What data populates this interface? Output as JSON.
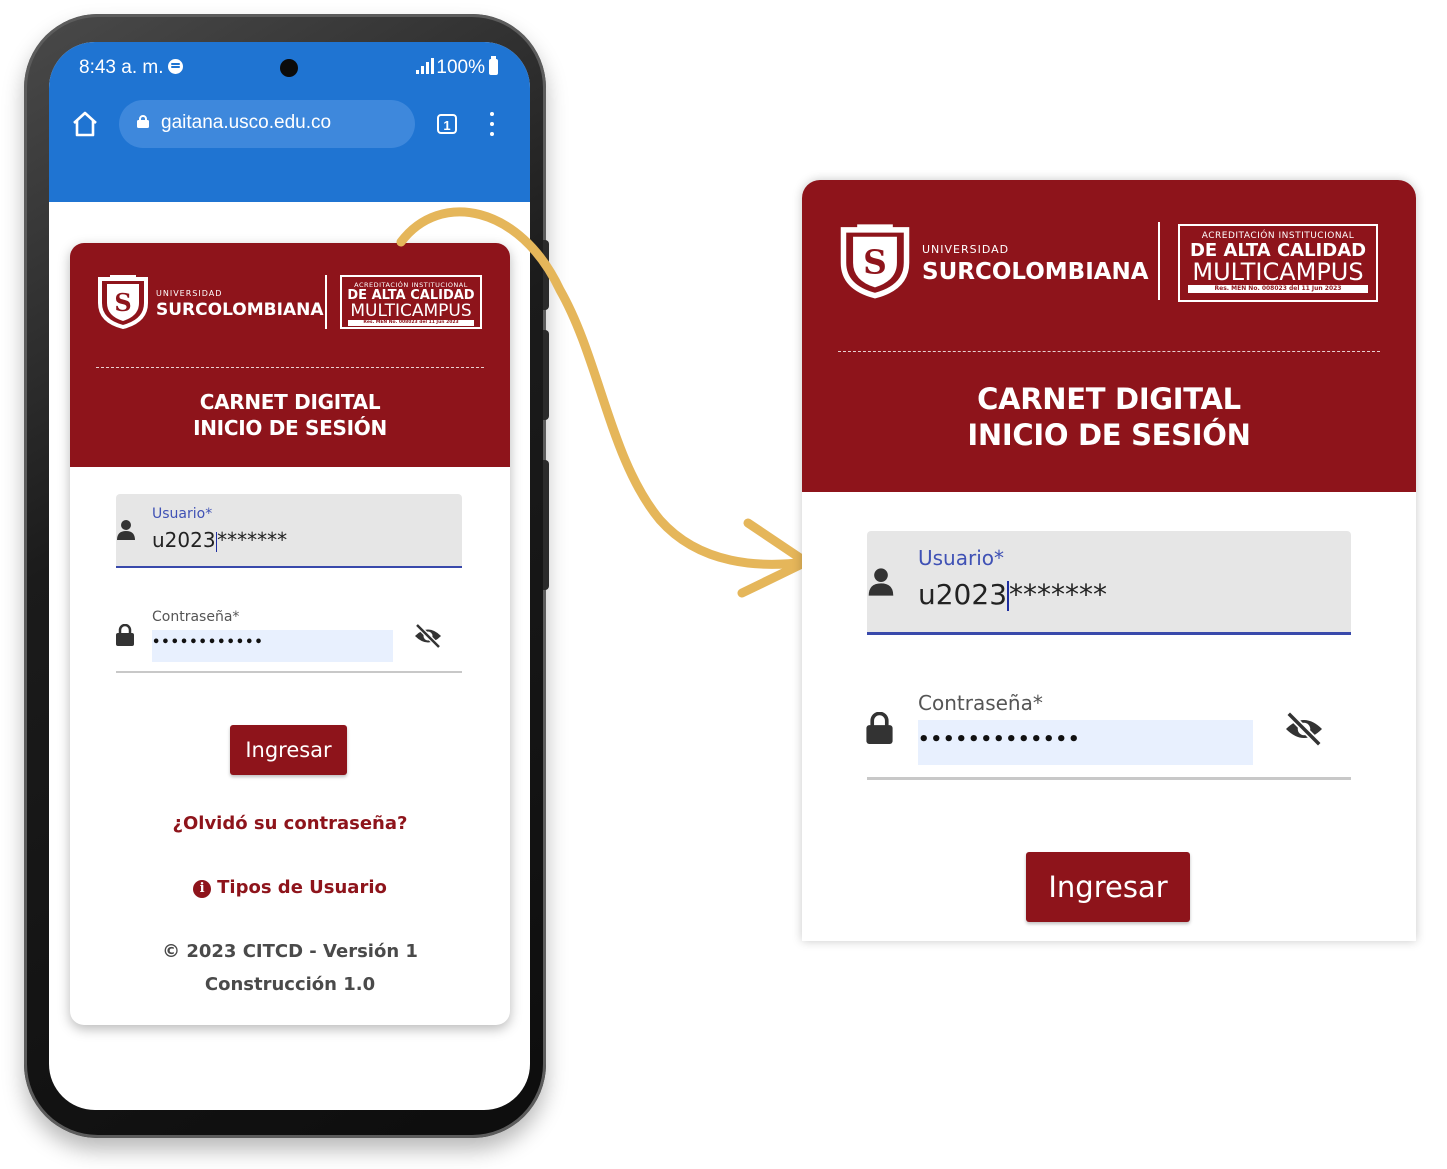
{
  "status_bar": {
    "time": "8:43 a. m.",
    "battery": "100%"
  },
  "browser": {
    "url": "gaitana.usco.edu.co",
    "tab_count": "1"
  },
  "logo": {
    "university_small": "UNIVERSIDAD",
    "university_name": "SURCOLOMBIANA",
    "accreditation_line1": "ACREDITACIÓN INSTITUCIONAL",
    "accreditation_line2": "DE ALTA CALIDAD",
    "accreditation_line3": "MULTICAMPUS",
    "accreditation_line4": "Res. MEN No. 008023 del 11 Jun 2023"
  },
  "title": {
    "line1": "CARNET DIGITAL",
    "line2": "INICIO DE SESIÓN"
  },
  "form": {
    "user_label": "Usuario*",
    "user_value_typed": "u2023",
    "user_value_masked": "*******",
    "password_label": "Contraseña*",
    "password_dots_small": "••••••••••••",
    "password_dots_big": "•••••••••••••",
    "submit_label": "Ingresar"
  },
  "links": {
    "forgot_password": "¿Olvidó su contraseña?",
    "user_types": "Tipos de Usuario"
  },
  "footer": {
    "line1": "© 2023 CITCD - Versión 1",
    "line2": "Construcción 1.0"
  },
  "colors": {
    "brand": "#8e141b",
    "browser_bar": "#1f74d2",
    "focus_line": "#3949ab",
    "arrow": "#e5b65a"
  },
  "icons": [
    "home-icon",
    "lock-icon",
    "tabs-icon",
    "more-vert-icon",
    "person-icon",
    "eye-off-icon",
    "info-icon",
    "spotify-icon",
    "signal-icon",
    "battery-icon"
  ]
}
